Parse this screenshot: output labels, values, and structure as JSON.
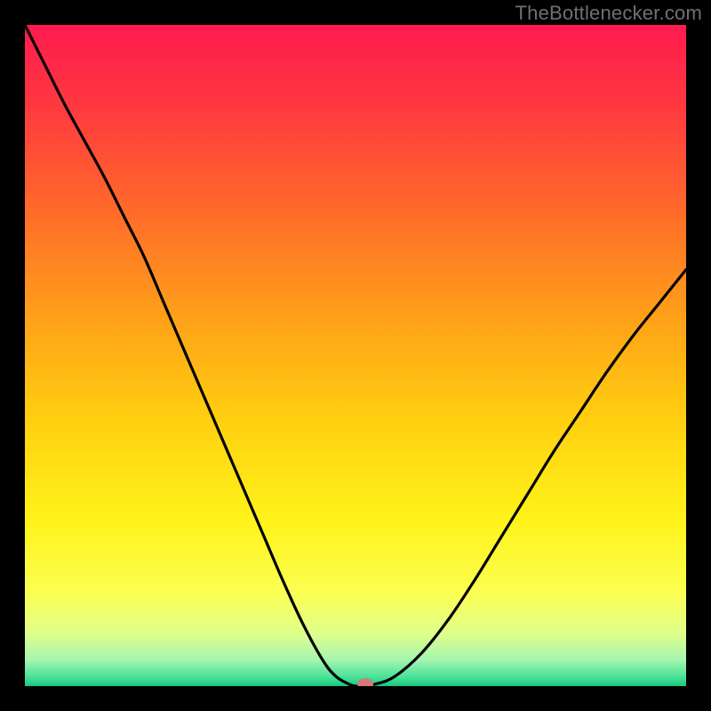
{
  "watermark": "TheBottlenecker.com",
  "chart_data": {
    "type": "line",
    "title": "",
    "xlabel": "",
    "ylabel": "",
    "xlim": [
      0,
      100
    ],
    "ylim": [
      0,
      100
    ],
    "x": [
      0,
      3,
      6,
      9,
      12,
      15,
      18,
      21,
      24,
      27,
      30,
      33,
      36,
      39,
      42,
      45,
      47,
      49,
      50,
      51,
      53,
      56,
      60,
      64,
      68,
      72,
      76,
      80,
      84,
      88,
      92,
      96,
      100
    ],
    "values": [
      100,
      94,
      88,
      82.5,
      77,
      71,
      65,
      58,
      51,
      44,
      37,
      30,
      23,
      16,
      9.5,
      4,
      1.5,
      0.3,
      0,
      0,
      0.3,
      1.5,
      5,
      10,
      16,
      22.5,
      29,
      35.5,
      41.5,
      47.5,
      53,
      58,
      63
    ],
    "marker": {
      "x": 51.5,
      "y": 0.3
    },
    "gradient_stops": [
      {
        "offset": 0.0,
        "color": "#ff1a4f"
      },
      {
        "offset": 0.12,
        "color": "#ff3840"
      },
      {
        "offset": 0.28,
        "color": "#ff6a2a"
      },
      {
        "offset": 0.45,
        "color": "#ffa318"
      },
      {
        "offset": 0.6,
        "color": "#ffd010"
      },
      {
        "offset": 0.75,
        "color": "#fff31a"
      },
      {
        "offset": 0.86,
        "color": "#fbff53"
      },
      {
        "offset": 0.92,
        "color": "#e0ff8a"
      },
      {
        "offset": 0.96,
        "color": "#a6f5b0"
      },
      {
        "offset": 0.985,
        "color": "#4fe29a"
      },
      {
        "offset": 1.0,
        "color": "#18c97d"
      }
    ],
    "marker_color": "#d87878",
    "curve_color": "#000000"
  }
}
